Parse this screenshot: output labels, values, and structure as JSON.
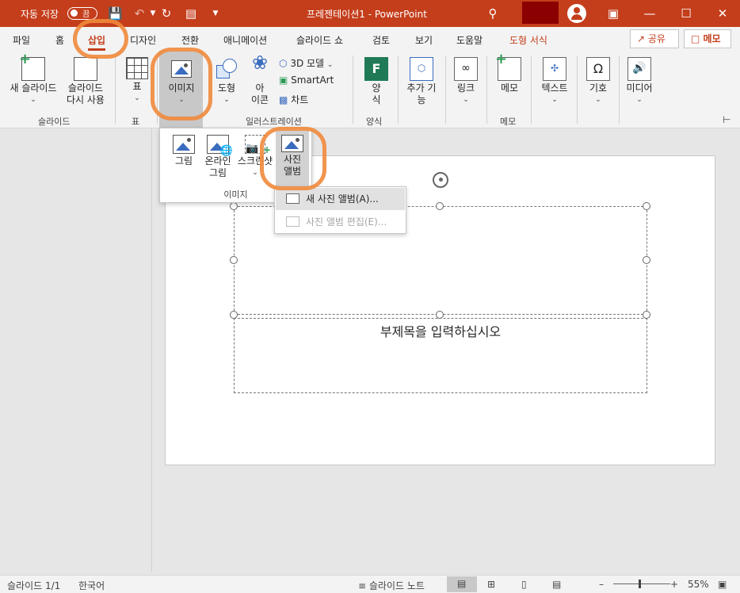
{
  "titlebar": {
    "autosave_label": "자동 저장",
    "autosave_state": "끔",
    "doc_title": "프레젠테이션1  -  PowerPoint"
  },
  "tabs": [
    "파일",
    "홈",
    "삽입",
    "디자인",
    "전환",
    "애니메이션",
    "슬라이드 쇼",
    "검토",
    "보기",
    "도움말",
    "도형 서식"
  ],
  "header_buttons": {
    "share": "공유",
    "memo": "메모"
  },
  "ribbon": {
    "new_slide": "새 슬라이드",
    "reuse_slide_1": "슬라이드",
    "reuse_slide_2": "다시 사용",
    "group_slides": "슬라이드",
    "table": "표",
    "group_table": "표",
    "images": "이미지",
    "shapes": "도형",
    "icons_1": "아",
    "icons_2": "이콘",
    "model3d": "3D 모델",
    "smartart": "SmartArt",
    "chart": "차트",
    "group_illustrations": "일러스트레이션",
    "forms_1": "양",
    "forms_2": "식",
    "group_forms": "양식",
    "addins_1": "추가 기",
    "addins_2": "능",
    "link": "링크",
    "memo": "메모",
    "group_memo": "메모",
    "text": "텍스트",
    "symbol": "기호",
    "media": "미디어"
  },
  "image_dropdown": {
    "picture": "그림",
    "online_1": "온라인",
    "online_2": "그림",
    "screenshot": "스크린샷",
    "album_1": "사진",
    "album_2": "앨범",
    "group_label": "이미지"
  },
  "album_menu": {
    "new_album": "새 사진 앨범(A)...",
    "edit_album": "사진 앨범 편집(E)..."
  },
  "slide": {
    "subtitle_placeholder": "부제목을 입력하십시오"
  },
  "statusbar": {
    "slide_count": "슬라이드 1/1",
    "language": "한국어",
    "notes": "슬라이드 노트",
    "zoom": "55%"
  }
}
